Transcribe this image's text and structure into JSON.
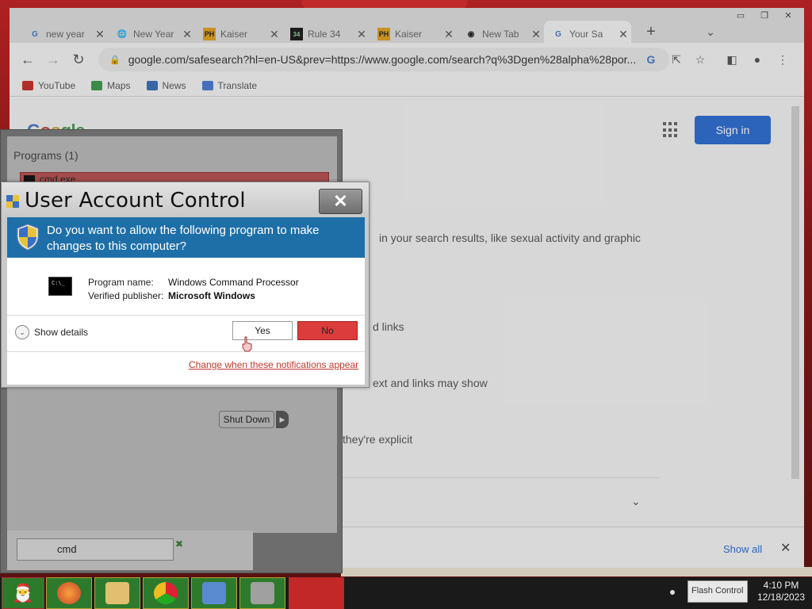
{
  "browser": {
    "tabs": [
      {
        "title": "new year",
        "icon": "google-g-icon"
      },
      {
        "title": "New Year",
        "icon": "globe-icon"
      },
      {
        "title": "Kaiser",
        "icon": "ph-icon"
      },
      {
        "title": "Rule 34",
        "icon": "r34-icon"
      },
      {
        "title": "Kaiser",
        "icon": "ph-icon"
      },
      {
        "title": "New Tab",
        "icon": "chrome-icon"
      },
      {
        "title": "Your Sa",
        "icon": "google-g-icon"
      }
    ],
    "new_tab": "+",
    "url": "google.com/safesearch?hl=en-US&prev=https://www.google.com/search?q%3Dgen%28alpha%28por...",
    "bookmarks": [
      {
        "label": "YouTube",
        "color": "#c4302b"
      },
      {
        "label": "Maps",
        "color": "#3c9a4c"
      },
      {
        "label": "News",
        "color": "#3b6fb6"
      },
      {
        "label": "Translate",
        "color": "#4a7ad0"
      }
    ]
  },
  "page": {
    "logo": {
      "g": "G",
      "o1": "o",
      "o2": "o",
      "rest": "gle"
    },
    "sign_in": "Sign in",
    "lines": [
      "in your search results, like sexual activity and graphic",
      "d links",
      "ext and links may show",
      "they're explicit"
    ],
    "downloads_show_all": "Show all",
    "downloads_close": "✕"
  },
  "start_menu": {
    "programs_header": "Programs (1)",
    "program_item": "cmd.exe",
    "search_value": "cmd",
    "shutdown_label": "Shut Down"
  },
  "uac": {
    "title": "User Account Control",
    "close": "✕",
    "question": "Do you want to allow the following program to make changes to this computer?",
    "program_name_label": "Program name:",
    "program_name": "Windows Command Processor",
    "publisher_label": "Verified publisher:",
    "publisher": "Microsoft Windows",
    "show_details": "Show details",
    "yes": "Yes",
    "no": "No",
    "change_link": "Change when these notifications appear",
    "prog_icon_text": "C:\\_",
    "colors": {
      "header": "#1e6fa8",
      "no_button": "#dd3c3c",
      "link": "#c0392b"
    }
  },
  "taskbar": {
    "notification": "Flash Control",
    "time": "4:10 PM",
    "date": "12/18/2023"
  }
}
